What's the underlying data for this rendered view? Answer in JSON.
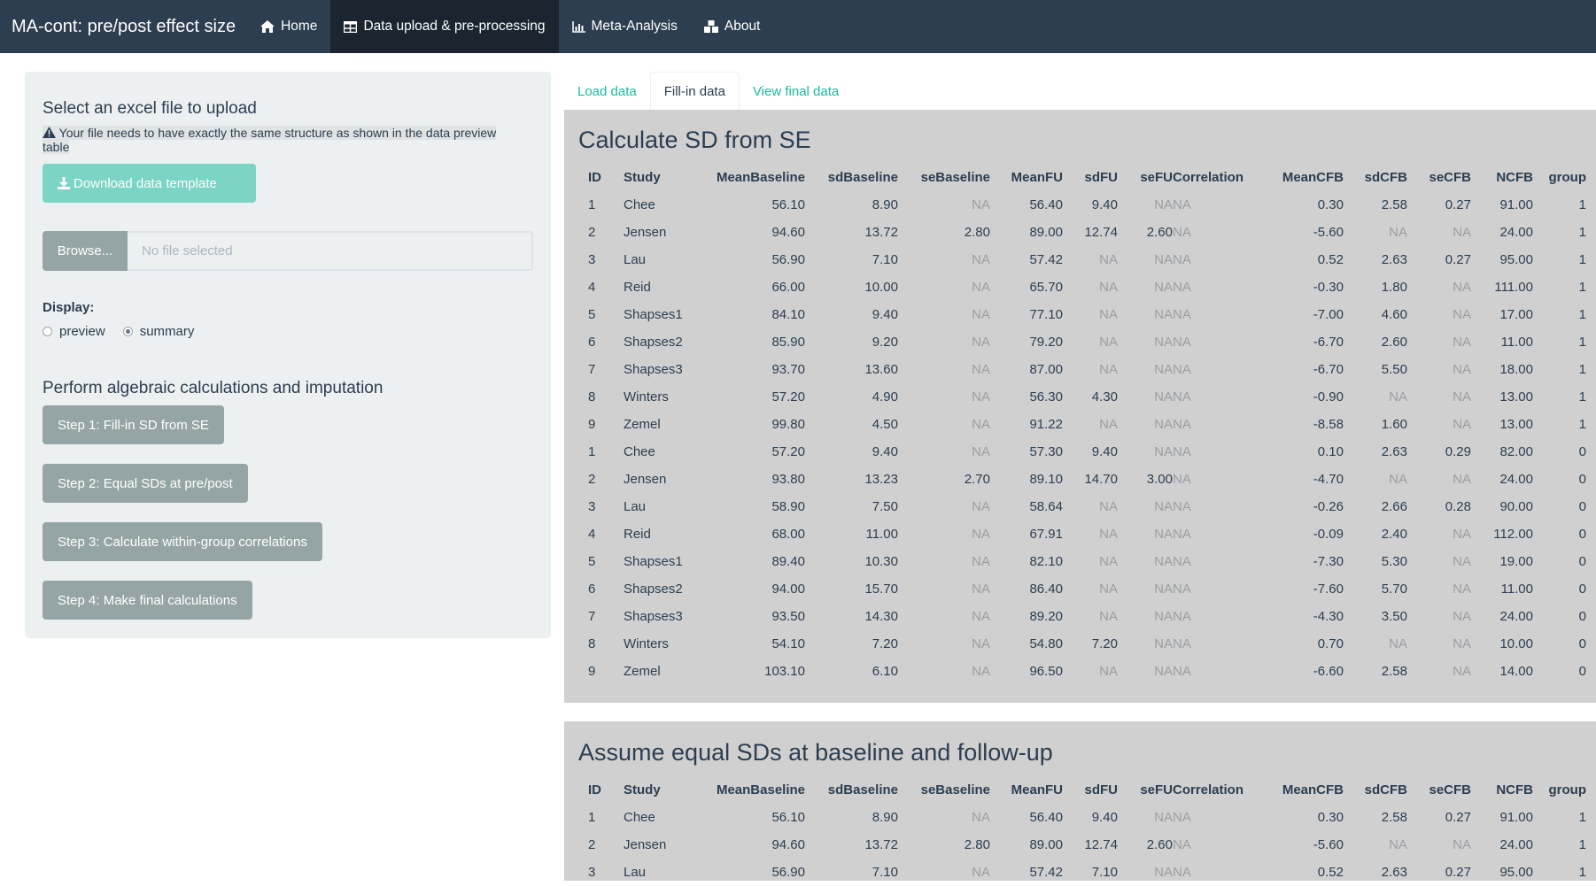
{
  "navbar": {
    "brand": "MA-cont: pre/post effect size",
    "items": [
      {
        "label": "Home",
        "icon": "home-icon"
      },
      {
        "label": "Data upload & pre-processing",
        "icon": "table-icon"
      },
      {
        "label": "Meta-Analysis",
        "icon": "bar-chart-icon"
      },
      {
        "label": "About",
        "icon": "cubes-icon"
      }
    ],
    "active_index": 1
  },
  "sidebar": {
    "upload_title": "Select an excel file to upload",
    "warning": "Your file needs to have exactly the same structure as shown in the data preview table",
    "download_button": "Download data template",
    "browse_button": "Browse...",
    "file_placeholder": "No file selected",
    "display_label": "Display:",
    "display_options": [
      "preview",
      "summary"
    ],
    "display_selected": "summary",
    "calc_title": "Perform algebraic calculations and imputation",
    "steps": [
      "Step 1: Fill-in SD from SE",
      "Step 2: Equal SDs at pre/post",
      "Step 3: Calculate within-group correlations",
      "Step 4: Make final calculations"
    ]
  },
  "tabs": [
    "Load data",
    "Fill-in data",
    "View final data"
  ],
  "active_tab": 1,
  "colors": {
    "navbar": "#2c3e50",
    "accent": "#18bc9c",
    "button_gray": "#95a5a6",
    "panel_gray": "#d0d0d0"
  },
  "columns": [
    "ID",
    "Study",
    "MeanBaseline",
    "sdBaseline",
    "seBaseline",
    "MeanFU",
    "sdFU",
    "seFU",
    "Correlation",
    "MeanCFB",
    "sdCFB",
    "seCFB",
    "NCFB",
    "group"
  ],
  "panel1": {
    "title": "Calculate SD from SE",
    "rows": [
      [
        "1",
        "Chee",
        "56.10",
        "8.90",
        "NA",
        "56.40",
        "9.40",
        "NA",
        "NA",
        "0.30",
        "2.58",
        "0.27",
        "91.00",
        "1"
      ],
      [
        "2",
        "Jensen",
        "94.60",
        "13.72",
        "2.80",
        "89.00",
        "12.74",
        "2.60",
        "NA",
        "-5.60",
        "NA",
        "NA",
        "24.00",
        "1"
      ],
      [
        "3",
        "Lau",
        "56.90",
        "7.10",
        "NA",
        "57.42",
        "NA",
        "NA",
        "NA",
        "0.52",
        "2.63",
        "0.27",
        "95.00",
        "1"
      ],
      [
        "4",
        "Reid",
        "66.00",
        "10.00",
        "NA",
        "65.70",
        "NA",
        "NA",
        "NA",
        "-0.30",
        "1.80",
        "NA",
        "111.00",
        "1"
      ],
      [
        "5",
        "Shapses1",
        "84.10",
        "9.40",
        "NA",
        "77.10",
        "NA",
        "NA",
        "NA",
        "-7.00",
        "4.60",
        "NA",
        "17.00",
        "1"
      ],
      [
        "6",
        "Shapses2",
        "85.90",
        "9.20",
        "NA",
        "79.20",
        "NA",
        "NA",
        "NA",
        "-6.70",
        "2.60",
        "NA",
        "11.00",
        "1"
      ],
      [
        "7",
        "Shapses3",
        "93.70",
        "13.60",
        "NA",
        "87.00",
        "NA",
        "NA",
        "NA",
        "-6.70",
        "5.50",
        "NA",
        "18.00",
        "1"
      ],
      [
        "8",
        "Winters",
        "57.20",
        "4.90",
        "NA",
        "56.30",
        "4.30",
        "NA",
        "NA",
        "-0.90",
        "NA",
        "NA",
        "13.00",
        "1"
      ],
      [
        "9",
        "Zemel",
        "99.80",
        "4.50",
        "NA",
        "91.22",
        "NA",
        "NA",
        "NA",
        "-8.58",
        "1.60",
        "NA",
        "13.00",
        "1"
      ],
      [
        "1",
        "Chee",
        "57.20",
        "9.40",
        "NA",
        "57.30",
        "9.40",
        "NA",
        "NA",
        "0.10",
        "2.63",
        "0.29",
        "82.00",
        "0"
      ],
      [
        "2",
        "Jensen",
        "93.80",
        "13.23",
        "2.70",
        "89.10",
        "14.70",
        "3.00",
        "NA",
        "-4.70",
        "NA",
        "NA",
        "24.00",
        "0"
      ],
      [
        "3",
        "Lau",
        "58.90",
        "7.50",
        "NA",
        "58.64",
        "NA",
        "NA",
        "NA",
        "-0.26",
        "2.66",
        "0.28",
        "90.00",
        "0"
      ],
      [
        "4",
        "Reid",
        "68.00",
        "11.00",
        "NA",
        "67.91",
        "NA",
        "NA",
        "NA",
        "-0.09",
        "2.40",
        "NA",
        "112.00",
        "0"
      ],
      [
        "5",
        "Shapses1",
        "89.40",
        "10.30",
        "NA",
        "82.10",
        "NA",
        "NA",
        "NA",
        "-7.30",
        "5.30",
        "NA",
        "19.00",
        "0"
      ],
      [
        "6",
        "Shapses2",
        "94.00",
        "15.70",
        "NA",
        "86.40",
        "NA",
        "NA",
        "NA",
        "-7.60",
        "5.70",
        "NA",
        "11.00",
        "0"
      ],
      [
        "7",
        "Shapses3",
        "93.50",
        "14.30",
        "NA",
        "89.20",
        "NA",
        "NA",
        "NA",
        "-4.30",
        "3.50",
        "NA",
        "24.00",
        "0"
      ],
      [
        "8",
        "Winters",
        "54.10",
        "7.20",
        "NA",
        "54.80",
        "7.20",
        "NA",
        "NA",
        "0.70",
        "NA",
        "NA",
        "10.00",
        "0"
      ],
      [
        "9",
        "Zemel",
        "103.10",
        "6.10",
        "NA",
        "96.50",
        "NA",
        "NA",
        "NA",
        "-6.60",
        "2.58",
        "NA",
        "14.00",
        "0"
      ]
    ]
  },
  "panel2": {
    "title": "Assume equal SDs at baseline and follow-up",
    "rows": [
      [
        "1",
        "Chee",
        "56.10",
        "8.90",
        "NA",
        "56.40",
        "9.40",
        "NA",
        "NA",
        "0.30",
        "2.58",
        "0.27",
        "91.00",
        "1"
      ],
      [
        "2",
        "Jensen",
        "94.60",
        "13.72",
        "2.80",
        "89.00",
        "12.74",
        "2.60",
        "NA",
        "-5.60",
        "NA",
        "NA",
        "24.00",
        "1"
      ],
      [
        "3",
        "Lau",
        "56.90",
        "7.10",
        "NA",
        "57.42",
        "7.10",
        "NA",
        "NA",
        "0.52",
        "2.63",
        "0.27",
        "95.00",
        "1"
      ]
    ]
  }
}
